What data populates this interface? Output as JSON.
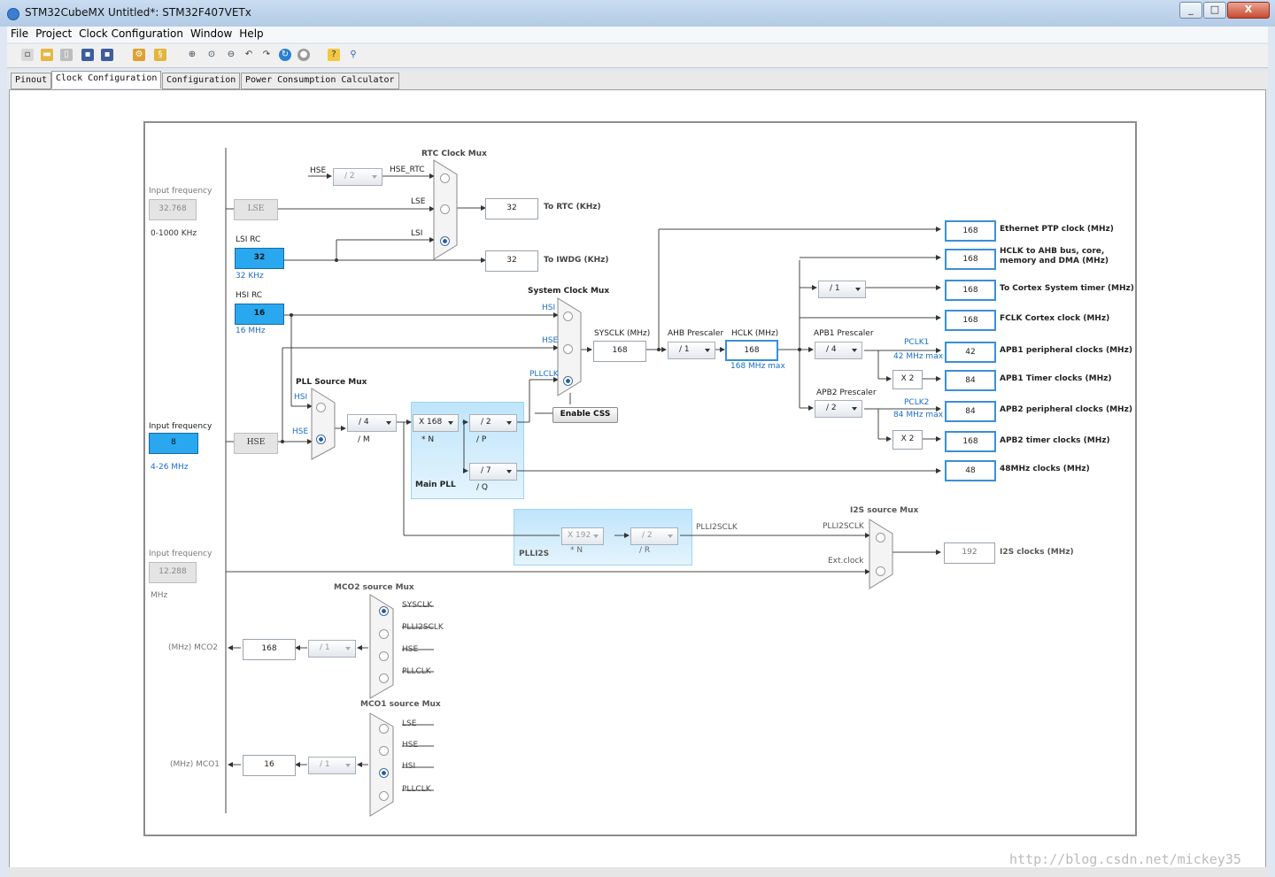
{
  "window": {
    "title": "STM32CubeMX Untitled*: STM32F407VETx",
    "buttons": [
      "_",
      "□",
      "X"
    ]
  },
  "menu": [
    "File",
    "Project",
    "Clock Configuration",
    "Window",
    "Help"
  ],
  "tabs": [
    "Pinout",
    "Clock Configuration",
    "Configuration",
    "Power Consumption Calculator"
  ],
  "colors": {
    "accent": "#29a8ef",
    "output_border": "#3a8fd8",
    "label_blue": "#1a6ec8"
  },
  "inputs": {
    "lse": {
      "label": "Input frequency",
      "value": "32.768",
      "range": "0-1000 KHz",
      "name": "LSE"
    },
    "lsi": {
      "label": "LSI RC",
      "value": "32",
      "unit": "32 KHz"
    },
    "hsi": {
      "label": "HSI RC",
      "value": "16",
      "unit": "16 MHz"
    },
    "hse": {
      "label": "Input frequency",
      "value": "8",
      "range": "4-26 MHz",
      "name": "HSE"
    },
    "i2s_ext": {
      "label": "Input frequency",
      "value": "12.288",
      "unit": "MHz"
    }
  },
  "rtc": {
    "mux_title": "RTC Clock Mux",
    "hse_label": "HSE",
    "div": "/ 2",
    "hse_rtc": "HSE_RTC",
    "lse_label": "LSE",
    "lsi_label": "LSI",
    "rtc_value": "32",
    "rtc_label": "To RTC (KHz)",
    "iwdg_value": "32",
    "iwdg_label": "To IWDG (KHz)"
  },
  "sysmux": {
    "title": "System Clock Mux",
    "hsi": "HSI",
    "hse": "HSE",
    "pllclk": "PLLCLK",
    "css": "Enable CSS"
  },
  "pll": {
    "src_title": "PLL Source Mux",
    "hsi": "HSI",
    "hse": "HSE",
    "m": "/ 4",
    "m_label": "/ M",
    "n": "X 168",
    "n_label": "* N",
    "p": "/ 2",
    "p_label": "/ P",
    "q": "/ 7",
    "q_label": "/ Q",
    "name": "Main PLL"
  },
  "sys": {
    "sysclk_label": "SYSCLK (MHz)",
    "sysclk": "168",
    "ahb_label": "AHB Prescaler",
    "ahb": "/ 1",
    "hclk_label": "HCLK (MHz)",
    "hclk": "168",
    "hclk_max": "168 MHz max",
    "cortex_div": "/ 1",
    "apb1_label": "APB1 Prescaler",
    "apb1": "/ 4",
    "pclk1": "PCLK1",
    "pclk1_max": "42 MHz max",
    "apb1_x": "X 2",
    "apb2_label": "APB2 Prescaler",
    "apb2": "/ 2",
    "pclk2": "PCLK2",
    "pclk2_max": "84 MHz max",
    "apb2_x": "X 2"
  },
  "outputs": [
    {
      "value": "168",
      "label": "Ethernet PTP clock (MHz)"
    },
    {
      "value": "168",
      "label": "HCLK to AHB bus, core,",
      "label2": "memory and DMA (MHz)"
    },
    {
      "value": "168",
      "label": "To Cortex System timer (MHz)"
    },
    {
      "value": "168",
      "label": "FCLK Cortex clock (MHz)"
    },
    {
      "value": "42",
      "label": "APB1 peripheral clocks (MHz)"
    },
    {
      "value": "84",
      "label": "APB1 Timer clocks (MHz)"
    },
    {
      "value": "84",
      "label": "APB2 peripheral clocks (MHz)"
    },
    {
      "value": "168",
      "label": "APB2 timer clocks (MHz)"
    },
    {
      "value": "48",
      "label": "48MHz clocks (MHz)"
    }
  ],
  "plli2s": {
    "name": "PLLI2S",
    "n": "X 192",
    "n_label": "* N",
    "r": "/ 2",
    "r_label": "/ R",
    "out": "PLLI2SCLK",
    "mux_title": "I2S source Mux",
    "mux_in1": "PLLI2SCLK",
    "mux_in2": "Ext.clock",
    "value": "192",
    "label": "I2S clocks (MHz)"
  },
  "mco2": {
    "mux_title": "MCO2 source Mux",
    "inputs": [
      "SYSCLK",
      "PLLI2SCLK",
      "HSE",
      "PLLCLK"
    ],
    "label": "(MHz) MCO2",
    "value": "168",
    "div": "/ 1"
  },
  "mco1": {
    "mux_title": "MCO1 source Mux",
    "inputs": [
      "LSE",
      "HSE",
      "HSI",
      "PLLCLK"
    ],
    "label": "(MHz) MCO1",
    "value": "16",
    "div": "/ 1"
  },
  "watermark": "http://blog.csdn.net/mickey35"
}
